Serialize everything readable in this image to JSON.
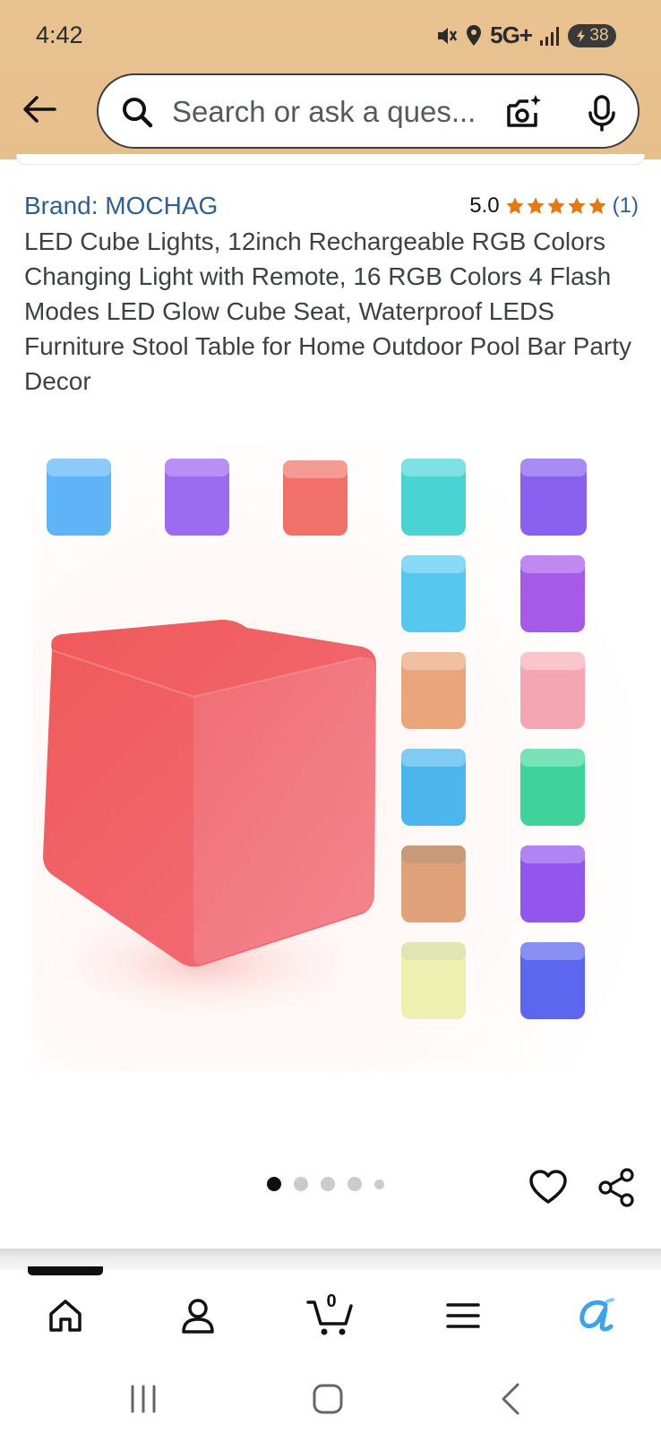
{
  "status_bar": {
    "time": "4:42",
    "network": "5G+",
    "battery": "38"
  },
  "search": {
    "placeholder": "Search or ask a ques..."
  },
  "product": {
    "brand": "Brand: MOCHAG",
    "rating_value": "5.0",
    "rating_count": "(1)",
    "stars": 5,
    "title": "LED Cube Lights, 12inch Rechargeable RGB Colors Changing Light with Remote, 16 RGB Colors 4 Flash Modes LED Glow Cube Seat, Waterproof LEDS Furniture Stool Table for Home Outdoor Pool Bar Party Decor"
  },
  "carousel": {
    "total": 5,
    "active_index": 0
  },
  "bottom_nav": {
    "cart_count": "0",
    "items": [
      "home-icon",
      "account-icon",
      "cart-icon",
      "menu-icon",
      "rufus-icon"
    ]
  },
  "colors": {
    "header_bg": "#e9c291",
    "link": "#2f5f8f",
    "star": "#e47911",
    "rufus": "#3ea3e6"
  }
}
